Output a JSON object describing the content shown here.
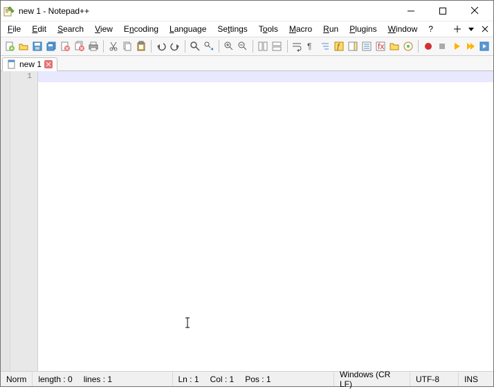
{
  "window": {
    "title": "new 1 - Notepad++"
  },
  "menu": {
    "file": "File",
    "edit": "Edit",
    "search": "Search",
    "view": "View",
    "encoding": "Encoding",
    "language": "Language",
    "settings": "Settings",
    "tools": "Tools",
    "macro": "Macro",
    "run": "Run",
    "plugins": "Plugins",
    "window": "Window",
    "help": "?"
  },
  "tab": {
    "name": "new 1"
  },
  "gutter": {
    "line1": "1"
  },
  "status": {
    "norm": "Norm",
    "length": "length : 0",
    "lines": "lines : 1",
    "ln": "Ln : 1",
    "col": "Col : 1",
    "pos": "Pos : 1",
    "eol": "Windows (CR LF)",
    "encoding": "UTF-8",
    "mode": "INS"
  }
}
